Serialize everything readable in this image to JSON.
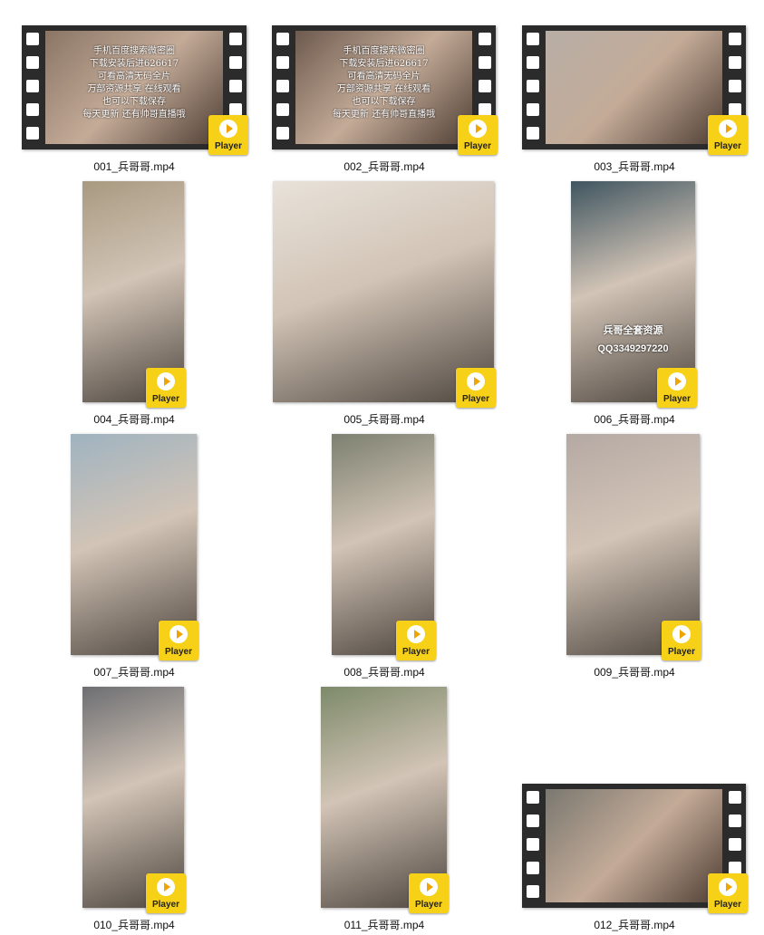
{
  "player_label": "Player",
  "files": [
    {
      "name": "001_兵哥哥.mp4",
      "style": "film",
      "overlay": [
        "手机百度搜索微密圈",
        "下载安装后进626617",
        "可看高清无码全片",
        "万部资源共享 在线观看",
        "也可以下载保存",
        "每天更新 还有帅哥直播哦"
      ]
    },
    {
      "name": "002_兵哥哥.mp4",
      "style": "film",
      "overlay": [
        "手机百度搜索微密圈",
        "下载安装后进626617",
        "可看高清无码全片",
        "万部资源共享 在线观看",
        "也可以下载保存",
        "每天更新 还有帅哥直播哦"
      ]
    },
    {
      "name": "003_兵哥哥.mp4",
      "style": "film"
    },
    {
      "name": "004_兵哥哥.mp4",
      "style": "plain"
    },
    {
      "name": "005_兵哥哥.mp4",
      "style": "plain"
    },
    {
      "name": "006_兵哥哥.mp4",
      "style": "plain",
      "overlay2": [
        "兵哥全套资源",
        "QQ3349297220"
      ]
    },
    {
      "name": "007_兵哥哥.mp4",
      "style": "plain"
    },
    {
      "name": "008_兵哥哥.mp4",
      "style": "plain"
    },
    {
      "name": "009_兵哥哥.mp4",
      "style": "plain"
    },
    {
      "name": "010_兵哥哥.mp4",
      "style": "plain"
    },
    {
      "name": "011_兵哥哥.mp4",
      "style": "plain"
    },
    {
      "name": "012_兵哥哥.mp4",
      "style": "film"
    }
  ]
}
